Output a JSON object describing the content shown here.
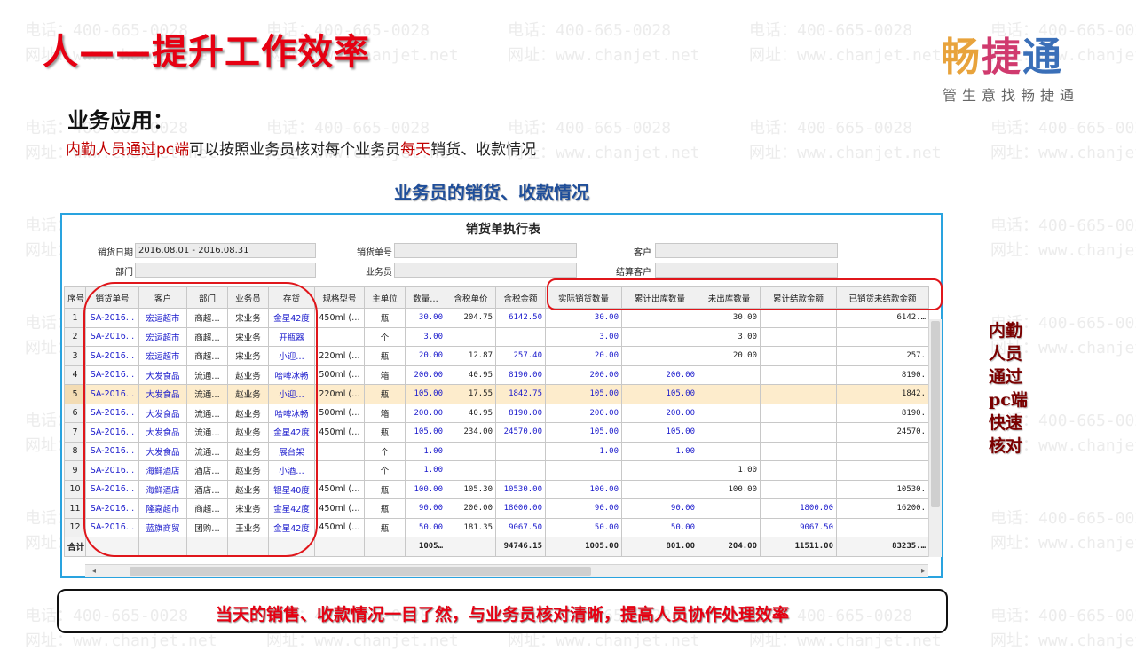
{
  "slide": {
    "title": "人——提升工作效率",
    "logo_text": [
      "畅",
      "捷",
      "通"
    ],
    "logo_slogan": "管生意找畅捷通",
    "watermark_phone": "电话：400-665-0028",
    "watermark_site": "网址：www.chanjet.net",
    "section_heading": "业务应用：",
    "desc_part1": "内勤人员通过pc端",
    "desc_part2": "可以按照业务员核对每个业务员",
    "desc_part3": "每天",
    "desc_part4": "销货、收款情况",
    "table_caption": "业务员的销货、收款情况",
    "side_note": [
      "内勤",
      "人员",
      "通过",
      "pc端",
      "快速",
      "核对"
    ],
    "summary": "当天的销售、收款情况一目了然，与业务员核对清晰，提高人员协作处理效率"
  },
  "report": {
    "title": "销货单执行表",
    "filters": {
      "sales_date_label": "销货日期",
      "sales_date_value": "2016.08.01 - 2016.08.31",
      "doc_no_label": "销货单号",
      "doc_no_value": "",
      "customer_label": "客户",
      "customer_value": "",
      "dept_label": "部门",
      "dept_value": "",
      "salesman_label": "业务员",
      "salesman_value": "",
      "settle_customer_label": "结算客户",
      "settle_customer_value": ""
    },
    "columns": [
      "序号",
      "销货单号",
      "客户",
      "部门",
      "业务员",
      "存货",
      "规格型号",
      "主单位",
      "数量…",
      "含税单价",
      "含税金额",
      "实际销货数量",
      "累计出库数量",
      "未出库数量",
      "累计结款金额",
      "已销货未结款金额"
    ],
    "rows": [
      [
        "1",
        "SA-2016…",
        "宏运超市",
        "商超…",
        "宋业务",
        "金星42度",
        "450ml (…",
        "瓶",
        "30.00",
        "204.75",
        "6142.50",
        "30.00",
        "",
        "30.00",
        "",
        "6142.…"
      ],
      [
        "2",
        "SA-2016…",
        "宏运超市",
        "商超…",
        "宋业务",
        "开瓶器",
        "",
        "个",
        "3.00",
        "",
        "",
        "3.00",
        "",
        "3.00",
        "",
        ""
      ],
      [
        "3",
        "SA-2016…",
        "宏运超市",
        "商超…",
        "宋业务",
        "小迎…",
        "220ml (…",
        "瓶",
        "20.00",
        "12.87",
        "257.40",
        "20.00",
        "",
        "20.00",
        "",
        "257."
      ],
      [
        "4",
        "SA-2016…",
        "大发食品",
        "流通…",
        "赵业务",
        "哈啤冰畅",
        "500ml (…",
        "箱",
        "200.00",
        "40.95",
        "8190.00",
        "200.00",
        "200.00",
        "",
        "",
        "8190."
      ],
      [
        "5",
        "SA-2016…",
        "大发食品",
        "流通…",
        "赵业务",
        "小迎…",
        "220ml (…",
        "瓶",
        "105.00",
        "17.55",
        "1842.75",
        "105.00",
        "105.00",
        "",
        "",
        "1842."
      ],
      [
        "6",
        "SA-2016…",
        "大发食品",
        "流通…",
        "赵业务",
        "哈啤冰畅",
        "500ml (…",
        "箱",
        "200.00",
        "40.95",
        "8190.00",
        "200.00",
        "200.00",
        "",
        "",
        "8190."
      ],
      [
        "7",
        "SA-2016…",
        "大发食品",
        "流通…",
        "赵业务",
        "金星42度",
        "450ml (…",
        "瓶",
        "105.00",
        "234.00",
        "24570.00",
        "105.00",
        "105.00",
        "",
        "",
        "24570."
      ],
      [
        "8",
        "SA-2016…",
        "大发食品",
        "流通…",
        "赵业务",
        "展台架",
        "",
        "个",
        "1.00",
        "",
        "",
        "1.00",
        "1.00",
        "",
        "",
        ""
      ],
      [
        "9",
        "SA-2016…",
        "海鲜酒店",
        "酒店…",
        "赵业务",
        "小酒…",
        "",
        "个",
        "1.00",
        "",
        "",
        "",
        "",
        "1.00",
        "",
        ""
      ],
      [
        "10",
        "SA-2016…",
        "海鲜酒店",
        "酒店…",
        "赵业务",
        "银星40度",
        "450ml (…",
        "瓶",
        "100.00",
        "105.30",
        "10530.00",
        "100.00",
        "",
        "100.00",
        "",
        "10530."
      ],
      [
        "11",
        "SA-2016…",
        "隆嘉超市",
        "商超…",
        "宋业务",
        "金星42度",
        "450ml (…",
        "瓶",
        "90.00",
        "200.00",
        "18000.00",
        "90.00",
        "90.00",
        "",
        "1800.00",
        "16200."
      ],
      [
        "12",
        "SA-2016…",
        "蓝旗商贸",
        "团购…",
        "王业务",
        "金星42度",
        "450ml (…",
        "瓶",
        "50.00",
        "181.35",
        "9067.50",
        "50.00",
        "50.00",
        "",
        "9067.50",
        ""
      ]
    ],
    "totals": [
      "合计",
      "",
      "",
      "",
      "",
      "",
      "",
      "",
      "1005…",
      "",
      "94746.15",
      "1005.00",
      "801.00",
      "204.00",
      "11511.00",
      "83235.…"
    ],
    "highlighted_row_index": 4
  }
}
